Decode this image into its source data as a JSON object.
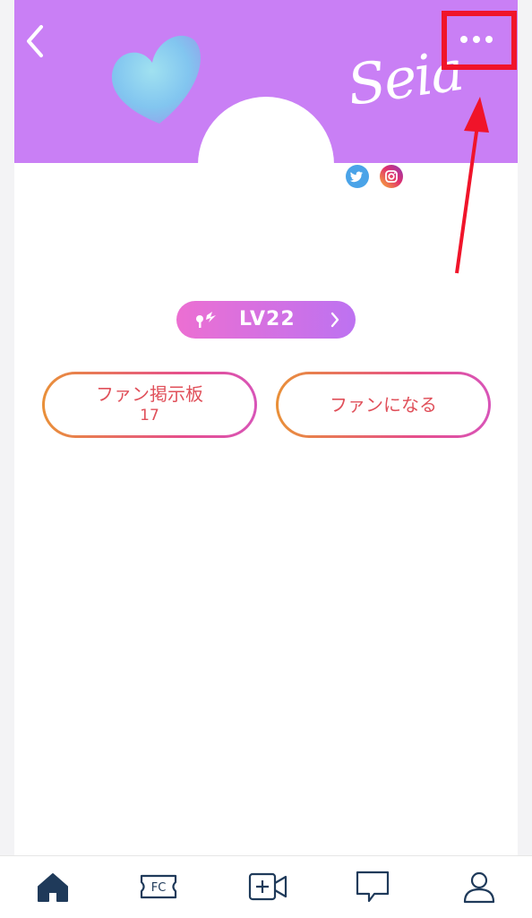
{
  "profile": {
    "cover_signature": "Seia",
    "level_label": "LV22"
  },
  "actions": {
    "board_label": "ファン掲示板",
    "board_count": "17",
    "become_fan_label": "ファンになる"
  },
  "icons": {
    "back": "chevron-left-icon",
    "more": "more-horizontal-icon",
    "twitter": "twitter-icon",
    "instagram": "instagram-icon",
    "level": "key-icon",
    "tabs": [
      "home-icon",
      "fc-ticket-icon",
      "add-video-icon",
      "chat-icon",
      "profile-icon"
    ]
  },
  "colors": {
    "cover": "#c97ff5",
    "accent_red": "#f0142a",
    "button_text": "#e0505a",
    "tab_active": "#1f3a5a"
  },
  "tabbar": {
    "fc_label": "FC"
  }
}
